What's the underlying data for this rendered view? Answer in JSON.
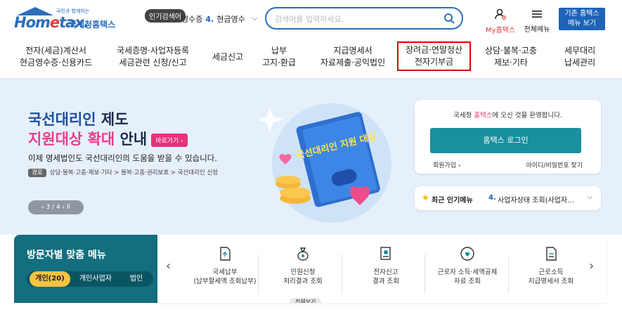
{
  "header": {
    "logo": {
      "slogan": "국민과 함께하는",
      "brand_pre": "Hom",
      "brand_e": "e",
      "brand_post": "tax.",
      "name_ko": "국세청홈택스"
    },
    "popular_badge": "인기검색어",
    "popular_rotator": {
      "prefix": "영수증",
      "num": "4.",
      "term": "현금영수"
    },
    "search": {
      "placeholder": "검색어를 입력하세요."
    },
    "my_hometax": "My홈택스",
    "all_menu": "전체메뉴",
    "legacy_menu": {
      "line1": "기존 홈택스",
      "line2": "메뉴 보기"
    }
  },
  "gnb": [
    {
      "line1": "전자(세금)계산서",
      "line2": "현금영수증·신용카드"
    },
    {
      "line1": "국세증명·사업자등록",
      "line2": "세금관련 신청/신고"
    },
    {
      "line1": "세금신고",
      "line2": ""
    },
    {
      "line1": "납부",
      "line2": "고지·환급"
    },
    {
      "line1": "지급명세서",
      "line2": "자료제출·공익법인"
    },
    {
      "line1": "장려금·연말정산",
      "line2": "전자기부금"
    },
    {
      "line1": "상담·불복·고충",
      "line2": "제보·기타"
    },
    {
      "line1": "세무대리",
      "line2": "납세관리"
    }
  ],
  "hero": {
    "title1_a": "국선대리인",
    "title1_b": " 제도",
    "title2_a": "지원대상 확대",
    "title2_b": " 안내",
    "shortcut": "바로가기 ›",
    "desc": "이제 영세법인도 국선대리인의 도움을 받을 수 있습니다.",
    "path_tag": "경로",
    "path": "상담·불복·고충·제보·기타 > 불복·고충·권리보호 > 국선대리인 신청",
    "pager": "‹  3 / 4  ›   ll",
    "image_text": "국선대리인 지원 대상"
  },
  "login": {
    "welcome_a": "국세청 ",
    "welcome_b": "홈택스",
    "welcome_c": "에 오신 것을 환영합니다.",
    "button": "홈택스 로그인",
    "join": "회원가입 ›",
    "find": "아이디/비밀번호 찾기"
  },
  "popular_menu": {
    "title": "최근 인기메뉴",
    "num": "4.",
    "item": "사업자상태 조회(사업자..."
  },
  "visitor": {
    "title": "방문자별 맞춤 메뉴",
    "tabs": [
      "개인(20)",
      "개인사업자",
      "법인"
    ],
    "items": [
      {
        "line1": "국세납부",
        "line2": "(납부할세액 조회납부)"
      },
      {
        "line1": "민원신청",
        "line2": "처리결과 조회"
      },
      {
        "line1": "전자신고",
        "line2": "결과 조회"
      },
      {
        "line1": "근로자 소득·세액공제",
        "line2": "자료 조회"
      },
      {
        "line1": "근로소득",
        "line2": "지급명세서 조회"
      }
    ],
    "view_all": "전체보기"
  },
  "colors": {
    "brand": "#2a6ebb",
    "teal": "#136e7e",
    "pink": "#e8327a",
    "highlight": "#e00000"
  }
}
